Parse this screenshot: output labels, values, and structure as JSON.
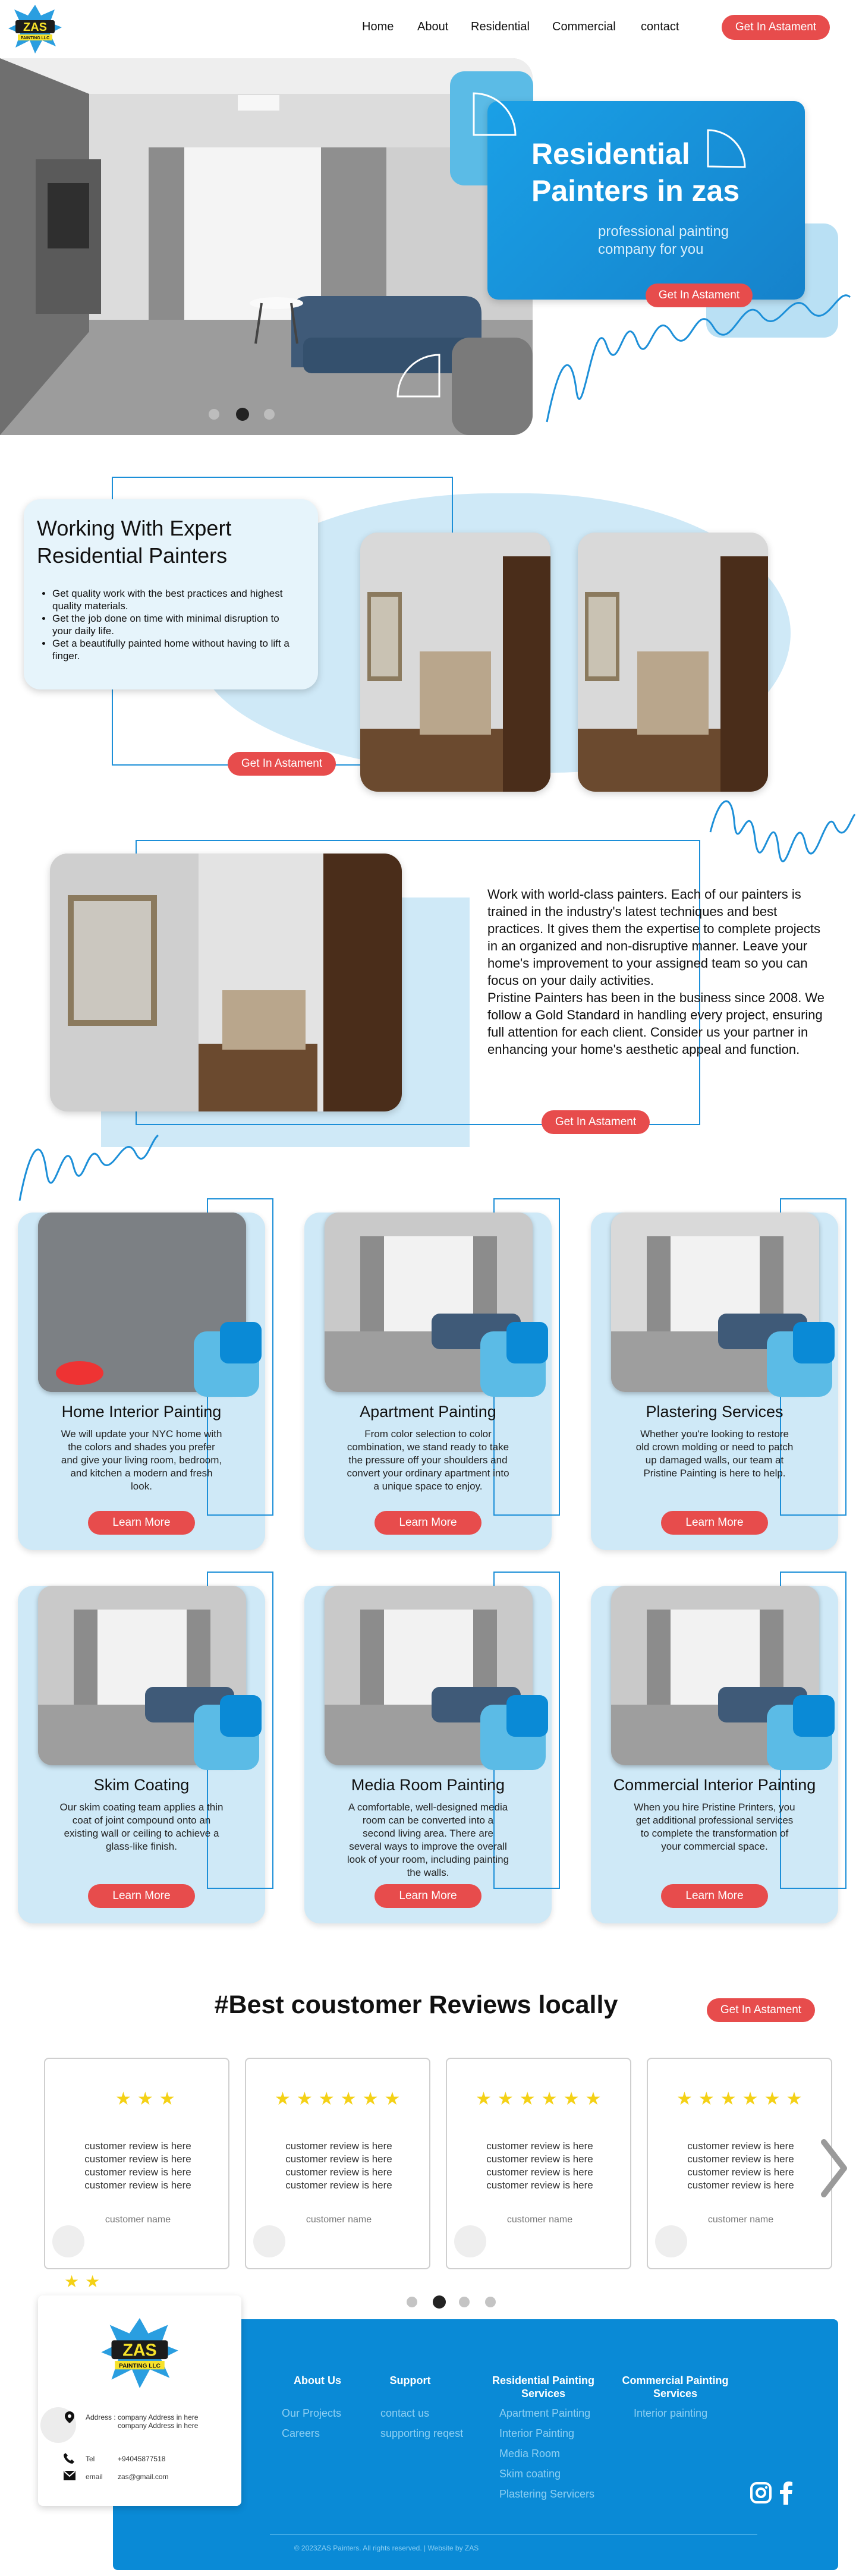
{
  "nav": {
    "items": [
      "Home",
      "About",
      "Residential",
      "Commercial",
      "contact"
    ],
    "cta": "Get In Astament"
  },
  "logo": {
    "text_top": "ZAS",
    "text_bottom": "PAINTING LLC"
  },
  "hero": {
    "title": "Residential Painters in zas",
    "subtitle": "professional painting company for you",
    "cta": "Get In Astament",
    "slider_dots": 3,
    "active_dot": 2
  },
  "expert": {
    "title": "Working With Expert Residential Painters",
    "bullets": [
      "Get quality work with the best practices and highest quality materials.",
      "Get the job done on time with minimal disruption to your daily life.",
      "Get a beautifully painted home without having to lift a finger."
    ],
    "cta": "Get In Astament"
  },
  "about": {
    "p1": "Work with world-class painters. Each of our painters is trained in the industry's latest techniques and best practices. It gives them the expertise to complete projects in an organized and non-disruptive manner. Leave your home's improvement to your assigned team so you can focus on your daily activities.",
    "p2": "Pristine Painters has been in the business since 2008. We follow a Gold Standard in handling every project, ensuring full attention for each client. Consider us your partner in enhancing your home's aesthetic appeal and function.",
    "cta": "Get In Astament"
  },
  "services": [
    {
      "title": "Home Interior Painting",
      "text": "We will update your NYC home with the colors and shades you prefer and give your living room, bedroom, and kitchen a modern and fresh look.",
      "button": "Learn More"
    },
    {
      "title": "Apartment Painting",
      "text": "From color selection to color combination, we stand ready to take the pressure off your shoulders and convert your ordinary apartment into a unique space to enjoy.",
      "button": "Learn More"
    },
    {
      "title": "Plastering Services",
      "text": "Whether you're looking to restore old crown molding or need to patch up damaged walls, our team at Pristine Painting is here to help.",
      "button": "Learn More"
    },
    {
      "title": "Skim Coating",
      "text": "Our skim coating team applies a thin coat of joint compound onto an existing wall or ceiling to achieve a glass-like finish.",
      "button": "Learn More"
    },
    {
      "title": "Media Room Painting",
      "text": "A comfortable, well-designed media room can be converted into a second living area. There are several ways to improve the overall look of your room, including painting the walls.",
      "button": "Learn More"
    },
    {
      "title": "Commercial Interior Painting",
      "text": "When you hire Pristine Printers, you get additional professional services to complete the transformation of your commercial space.",
      "button": "Learn More"
    }
  ],
  "reviews": {
    "title": "#Best coustomer Reviews locally",
    "cta": "Get In Astament",
    "cards": [
      {
        "stars": 3,
        "text": "customer review is here customer review is here customer review is here customer review is here",
        "name": "customer name"
      },
      {
        "stars": 6,
        "text": "customer review is here customer review is here customer review is here customer review is here",
        "name": "customer name"
      },
      {
        "stars": 6,
        "text": "customer review is here customer review is here customer review is here customer review is here",
        "name": "customer name"
      },
      {
        "stars": 6,
        "text": "customer review is here customer review is here customer review is here customer review is here",
        "name": "customer name"
      }
    ],
    "dots": 4,
    "active_dot": 2
  },
  "footer": {
    "card": {
      "address_label": "Address :",
      "address": "company Address in here company Address in here",
      "tel_label": "Tel",
      "tel": "+94045877518",
      "email_label": "email",
      "email": "zas@gmail.com"
    },
    "cols": [
      {
        "title": "About Us",
        "links": [
          "Our Projects",
          "Careers"
        ]
      },
      {
        "title": "Support",
        "links": [
          "contact us",
          "supporting reqest"
        ]
      },
      {
        "title": "Residential Painting Services",
        "links": [
          "Apartment Painting",
          "Interior Painting",
          "Media Room",
          "Skim coating",
          "Plastering Servicers"
        ]
      },
      {
        "title": "Commercial Painting Services",
        "links": [
          "Interior painting"
        ]
      }
    ],
    "copyright": "© 2023ZAS Painters. All rights reserved. | Website by ZAS"
  },
  "colors": {
    "accent": "#e74c4c",
    "blue": "#0a8ad6",
    "light_blue": "#5bbbe6",
    "pale_blue": "#cfe9f7",
    "star": "#f4d116"
  }
}
